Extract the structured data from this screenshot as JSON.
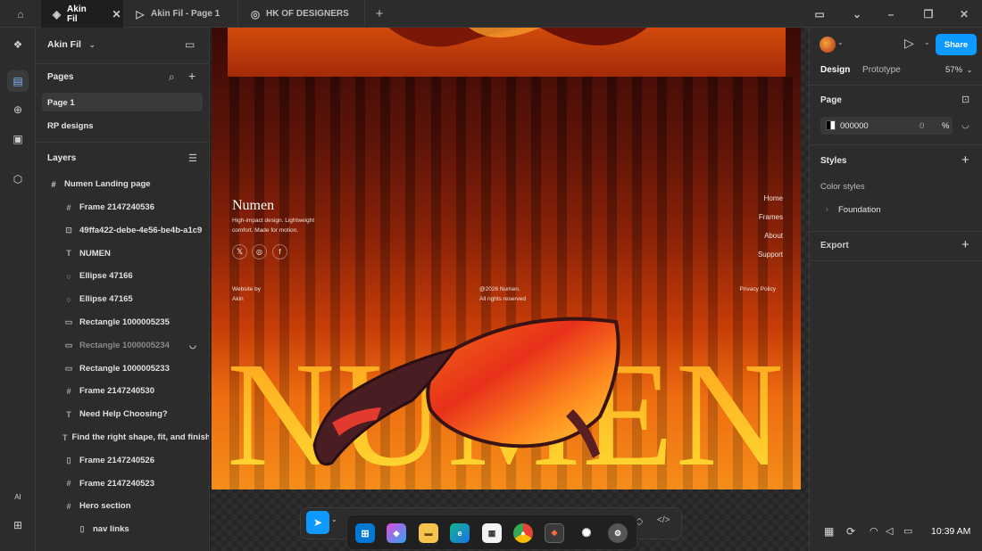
{
  "titlebar": {
    "tabs": [
      {
        "label": "Akin Fil",
        "icon": "figma-file-icon"
      },
      {
        "label": "Akin Fil - Page 1",
        "icon": "play-icon"
      },
      {
        "label": "HK OF DESIGNERS",
        "icon": "team-icon"
      }
    ]
  },
  "file": {
    "name": "Akin Fil"
  },
  "pages": {
    "header": "Pages",
    "items": [
      {
        "label": "Page 1",
        "selected": true
      },
      {
        "label": "RP designs",
        "selected": false
      }
    ]
  },
  "layers": {
    "header": "Layers",
    "root": "Numen Landing page",
    "items": [
      {
        "label": "Frame 2147240536",
        "icon": "frame-icon"
      },
      {
        "label": "49ffa422-debe-4e56-be4b-a1c9",
        "icon": "image-icon"
      },
      {
        "label": "NUMEN",
        "icon": "text-icon"
      },
      {
        "label": "Ellipse 47166",
        "icon": "ellipse-icon"
      },
      {
        "label": "Ellipse 47165",
        "icon": "ellipse-icon"
      },
      {
        "label": "Rectangle 1000005235",
        "icon": "rectangle-icon"
      },
      {
        "label": "Rectangle 1000005234",
        "icon": "rectangle-icon",
        "hidden": true
      },
      {
        "label": "Rectangle 1000005233",
        "icon": "rectangle-icon"
      },
      {
        "label": "Frame 2147240530",
        "icon": "frame-icon"
      },
      {
        "label": "Need Help Choosing?",
        "icon": "text-icon"
      },
      {
        "label": "Find the right shape, fit, and finish",
        "icon": "text-icon"
      },
      {
        "label": "Frame 2147240526",
        "icon": "autolayout-icon"
      },
      {
        "label": "Frame 2147240523",
        "icon": "frame-icon"
      },
      {
        "label": "Hero section",
        "icon": "frame-icon"
      },
      {
        "label": "nav links",
        "icon": "autolayout-icon"
      }
    ]
  },
  "artboard": {
    "brand": "Numen",
    "tagline_1": "High-impact design. Lightweight",
    "tagline_2": "comfort. Made for motion.",
    "nav": [
      "Home",
      "Frames",
      "About",
      "Support"
    ],
    "website_by_1": "Website by",
    "website_by_2": "Akin",
    "copyright_1": "@2026 Numen.",
    "copyright_2": "All rights reserved",
    "privacy": "Privacy Policy",
    "hero_word": "NUMEN"
  },
  "rightpanel": {
    "share": "Share",
    "tabs": [
      "Design",
      "Prototype"
    ],
    "zoom": "57%",
    "page_label": "Page",
    "page_color": "000000",
    "page_opacity": "0",
    "percent": "%",
    "styles_label": "Styles",
    "color_styles": "Color styles",
    "foundation": "Foundation",
    "export_label": "Export"
  },
  "tray": {
    "time": "10:39 AM"
  },
  "colors": {
    "accent": "#0d99ff",
    "panel": "#2c2c2c",
    "canvas_bg": "#1e1e1e"
  }
}
